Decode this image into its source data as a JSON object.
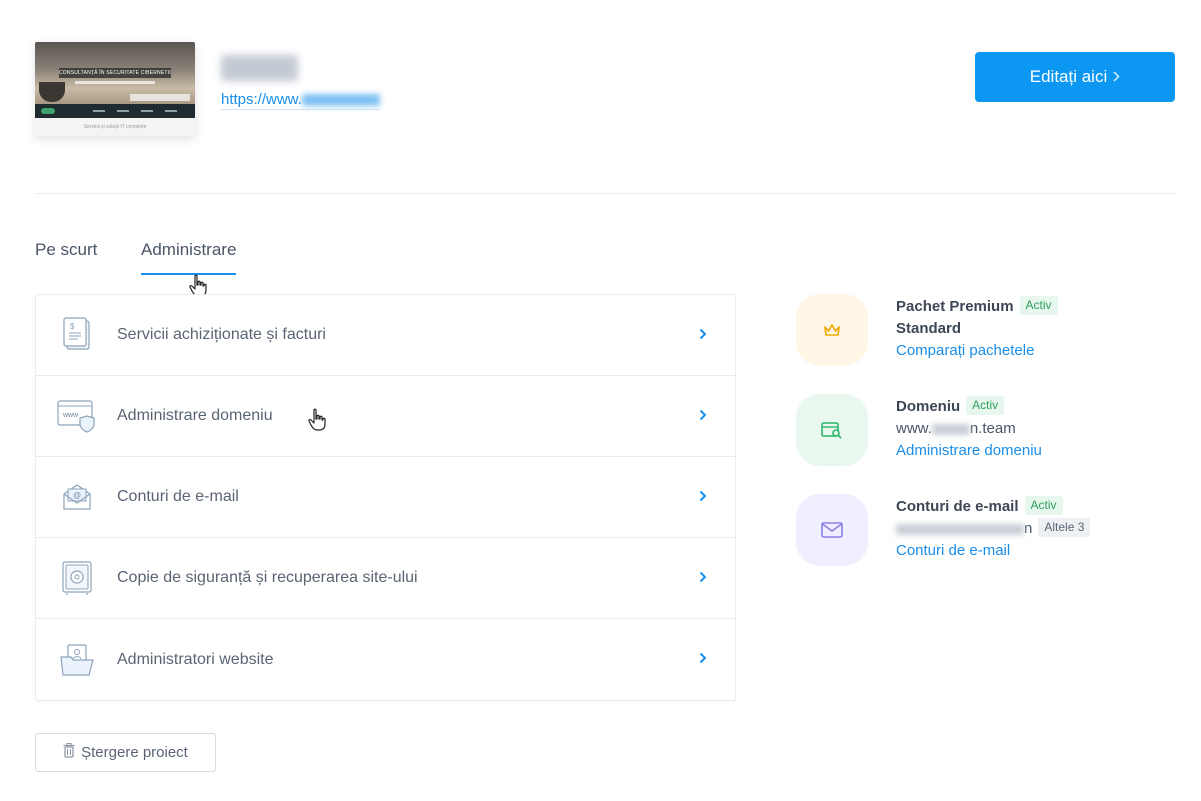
{
  "project": {
    "thumbnail": {
      "hero_title": "CONSULTANȚĂ ÎN SECURITATE CIBERNETICĂ",
      "footer_text": "Servicii și soluții IT complete"
    },
    "name_visible": "EMAN",
    "url_prefix": "https://www.",
    "edit_button_label": "Editați aici",
    "edit_button_icon": "chevron-right-icon"
  },
  "tabs": [
    {
      "label": "Pe scurt",
      "active": false
    },
    {
      "label": "Administrare",
      "active": true
    }
  ],
  "menu": [
    {
      "label": "Servicii achiziționate și facturi",
      "icon": "invoice-icon"
    },
    {
      "label": "Administrare domeniu",
      "icon": "www-shield-icon"
    },
    {
      "label": "Conturi de e-mail",
      "icon": "email-envelope-icon"
    },
    {
      "label": "Copie de siguranță și recuperarea site-ului",
      "icon": "safe-icon"
    },
    {
      "label": "Administratori website",
      "icon": "folder-user-icon"
    }
  ],
  "status": {
    "package": {
      "title_line1": "Pachet Premium",
      "title_line2": "Standard",
      "badge": "Activ",
      "link": "Comparați pachetele",
      "icon": "crown-icon",
      "bg": "#fff6e5",
      "color": "#f2a500"
    },
    "domain": {
      "title": "Domeniu",
      "badge": "Activ",
      "value_prefix": "www.",
      "value_suffix": "n.team",
      "link": "Administrare domeniu",
      "icon": "domain-search-icon",
      "bg": "#e9f8ef",
      "color": "#2bb46a"
    },
    "email": {
      "title": "Conturi de e-mail",
      "badge": "Activ",
      "value_suffix": "n",
      "more_badge": "Altele 3",
      "link": "Conturi de e-mail",
      "icon": "envelope-icon",
      "bg": "#f0efff",
      "color": "#8c7fe6"
    }
  },
  "delete_button_label": "Ștergere proiect",
  "colors": {
    "accent": "#1a8ee8",
    "primary_button": "#0b97f2",
    "active_badge_bg": "#e8f7ee",
    "active_badge_text": "#2f9e5b"
  }
}
